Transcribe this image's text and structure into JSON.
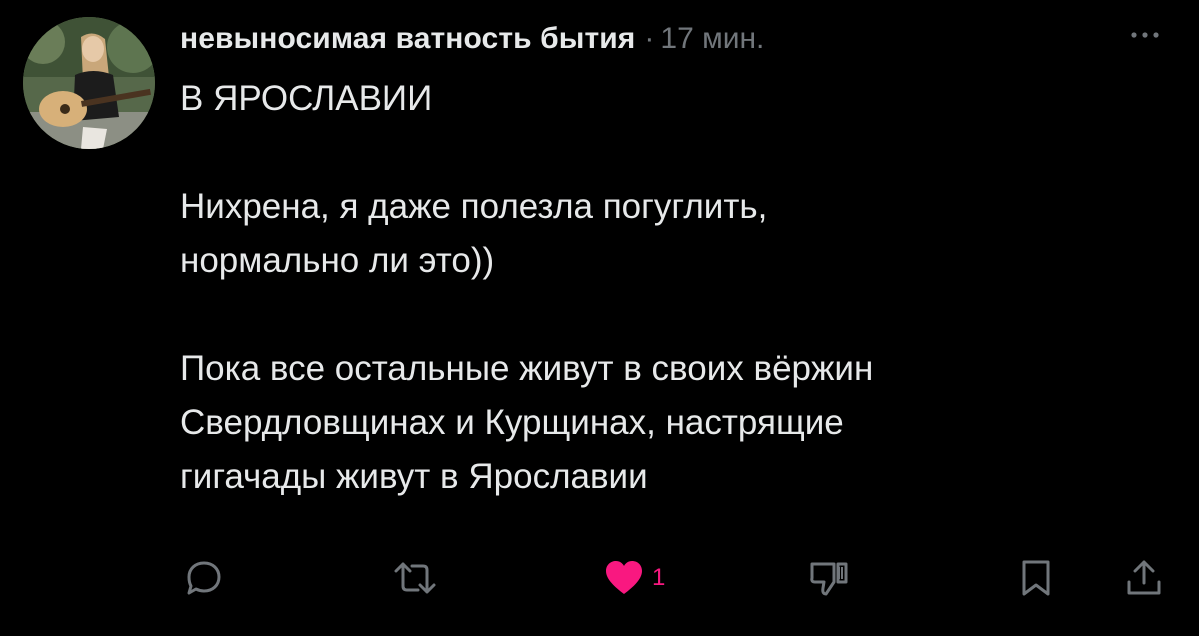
{
  "post": {
    "author_name": "невыносимая ватность бытия",
    "separator": "·",
    "timestamp": "17 мин.",
    "paragraphs": [
      "В ЯРОСЛАВИИ",
      "Нихрена, я даже полезла погуглить,\nнормально ли это))",
      "Пока все остальные живут в своих вёржин\nСвердловщинах и Курщинах, настрящие\nгигачады живут в Ярославии"
    ]
  },
  "actions": {
    "reply_icon": "speech-bubble-icon",
    "repost_icon": "repost-arrows-icon",
    "like_icon": "heart-filled-icon",
    "like_count": "1",
    "dislike_icon": "thumbs-down-icon",
    "bookmark_icon": "bookmark-icon",
    "share_icon": "share-upload-icon"
  },
  "colors": {
    "background": "#000000",
    "text": "#e7e9ea",
    "muted": "#71767b",
    "like": "#f91880"
  }
}
